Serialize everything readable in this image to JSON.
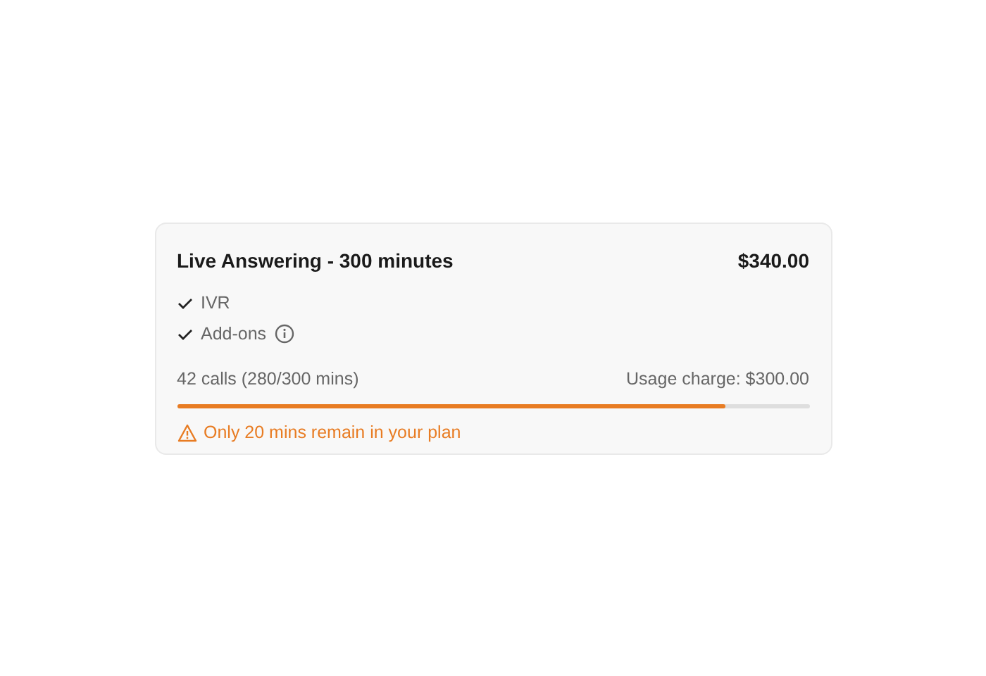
{
  "plan": {
    "title": "Live Answering - 300 minutes",
    "price": "$340.00",
    "features": [
      {
        "label": "IVR",
        "info": false
      },
      {
        "label": "Add-ons",
        "info": true
      }
    ],
    "usage": {
      "calls": "42 calls (280/300 mins)",
      "charge": "Usage charge: $300.00",
      "level": 0.867
    },
    "warning": "Only 20 mins remain in your plan"
  }
}
